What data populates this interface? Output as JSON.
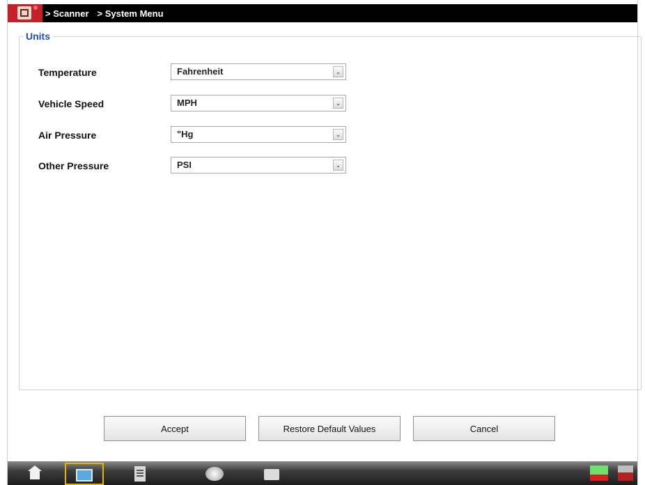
{
  "breadcrumb": [
    "> Scanner",
    "> System Menu"
  ],
  "units": {
    "title": "Units",
    "rows": [
      {
        "label": "Temperature",
        "value": "Fahrenheit"
      },
      {
        "label": "Vehicle Speed",
        "value": "MPH"
      },
      {
        "label": "Air Pressure",
        "value": "\"Hg"
      },
      {
        "label": "Other Pressure",
        "value": "PSI"
      }
    ]
  },
  "buttons": {
    "accept": "Accept",
    "restore": "Restore Default Values",
    "cancel": "Cancel"
  },
  "taskbar": {
    "icons": [
      "home-icon",
      "scanner-icon",
      "data-icon",
      "tools-icon",
      "print-icon",
      "network-status-icon",
      "battery-status-icon"
    ],
    "active": "scanner-icon"
  },
  "colors": {
    "titlebar": "#000000",
    "logo_red": "#c4202a",
    "group_title": "#1f4fa8",
    "active_outline": "#e7b400"
  }
}
